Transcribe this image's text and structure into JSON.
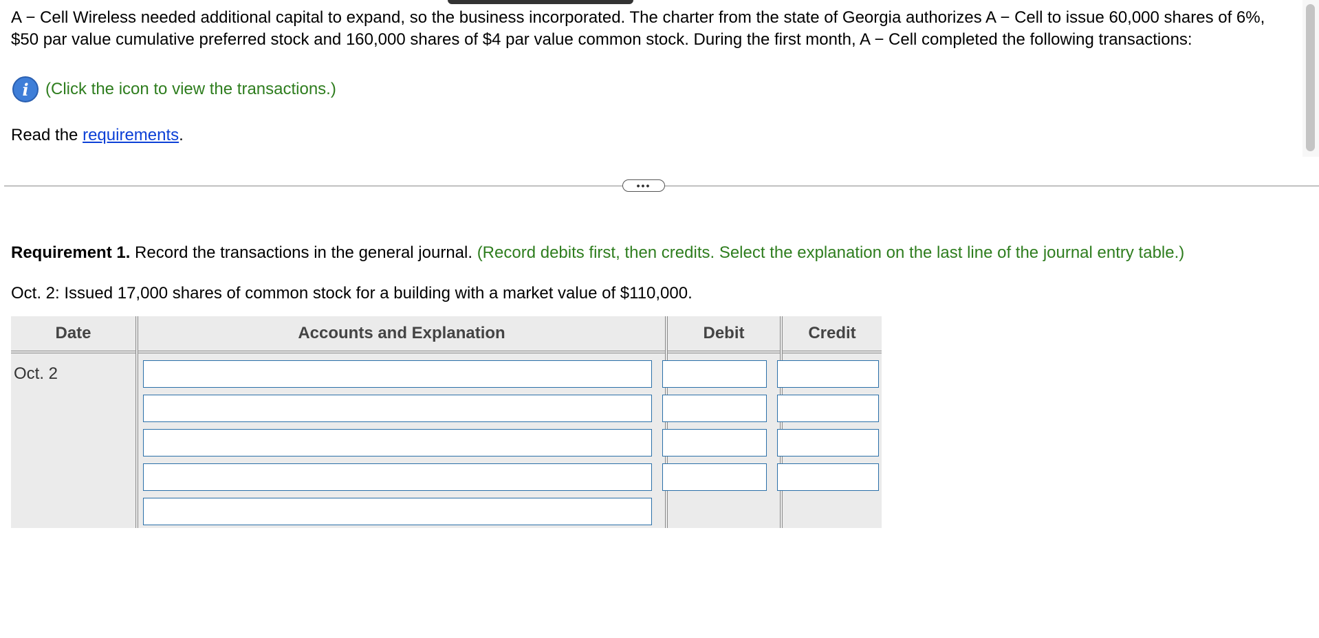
{
  "problem": {
    "text": "A − Cell Wireless needed additional capital to expand, so the business incorporated. The charter from the state of Georgia authorizes A − Cell to issue 60,000 shares of 6%, $50 par value cumulative preferred stock and 160,000 shares of $4 par value common stock. During the first month, A − Cell completed the following transactions:"
  },
  "info": {
    "icon_glyph": "i",
    "icon": "info-icon",
    "text": "(Click the icon to view the transactions.)"
  },
  "read_requirements": {
    "prefix": "Read the ",
    "link": "requirements",
    "suffix": "."
  },
  "divider": {
    "handle": "•••"
  },
  "requirement": {
    "label": "Requirement 1.",
    "text": " Record the transactions in the general journal. ",
    "hint": "(Record debits first, then credits. Select the explanation on the last line of the journal entry table.)"
  },
  "transaction": {
    "text": "Oct. 2: Issued 17,000 shares of common stock for a building with a market value of $110,000."
  },
  "journal": {
    "headers": {
      "date": "Date",
      "accounts": "Accounts and Explanation",
      "debit": "Debit",
      "credit": "Credit"
    },
    "date_value": "Oct. 2",
    "rows": [
      {
        "account": "",
        "debit": "",
        "credit": ""
      },
      {
        "account": "",
        "debit": "",
        "credit": ""
      },
      {
        "account": "",
        "debit": "",
        "credit": ""
      },
      {
        "account": "",
        "debit": "",
        "credit": ""
      },
      {
        "explanation": ""
      }
    ]
  },
  "colors": {
    "hint_green": "#2e7d1e",
    "link_blue": "#0b3fd6",
    "info_blue": "#3e7ed8",
    "input_border": "#2a6fa8",
    "table_bg": "#ebebeb"
  }
}
